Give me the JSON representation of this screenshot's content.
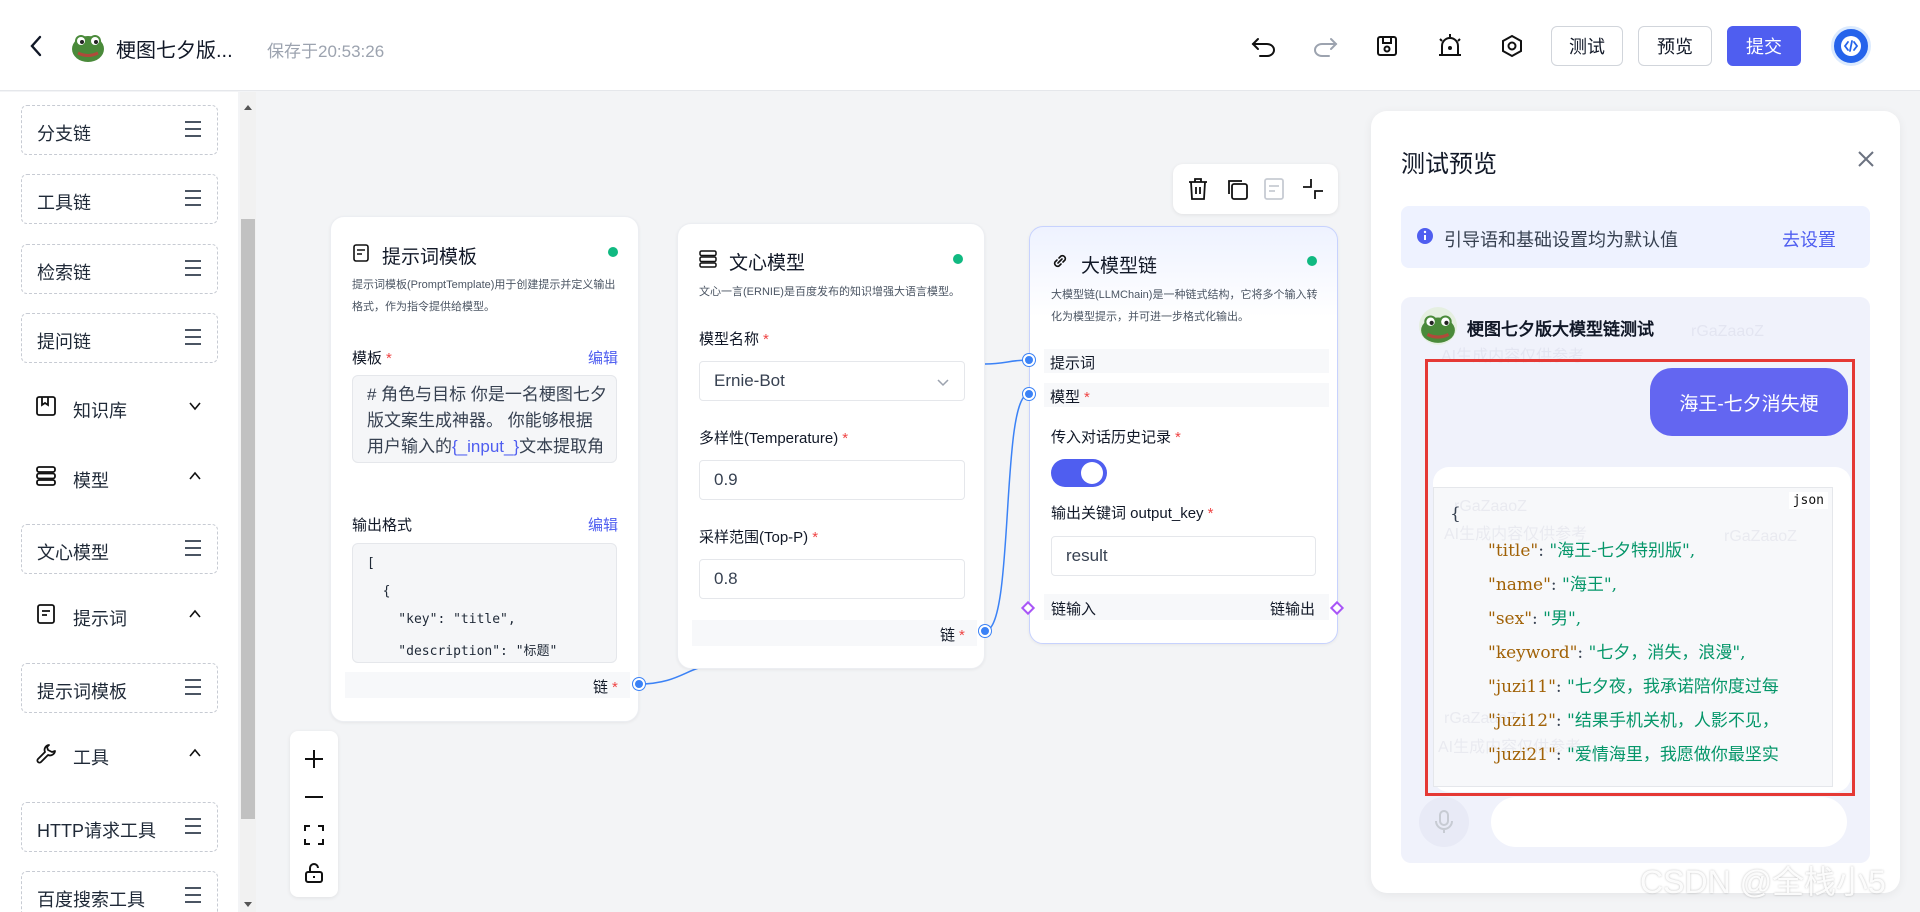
{
  "header": {
    "title": "梗图七夕版...",
    "saved_time": "保存于20:53:26",
    "buttons": {
      "test": "测试",
      "preview": "预览",
      "submit": "提交"
    }
  },
  "sidebar": {
    "items": [
      {
        "label": "分支链"
      },
      {
        "label": "工具链"
      },
      {
        "label": "检索链"
      },
      {
        "label": "提问链"
      }
    ],
    "groups": [
      {
        "label": "知识库",
        "expanded": false
      },
      {
        "label": "模型",
        "expanded": true,
        "items": [
          {
            "label": "文心模型"
          }
        ]
      },
      {
        "label": "提示词",
        "expanded": true,
        "items": [
          {
            "label": "提示词模板"
          }
        ]
      },
      {
        "label": "工具",
        "expanded": true,
        "items": [
          {
            "label": "HTTP请求工具"
          },
          {
            "label": "百度搜索工具"
          }
        ]
      }
    ]
  },
  "nodes": {
    "prompt": {
      "title": "提示词模板",
      "desc": "提示词模板(PromptTemplate)用于创建提示并定义输出格式，作为指令提供给模型。",
      "template_label": "模板",
      "edit": "编辑",
      "template_text_1": "# 角色与目标 你是一名梗图七夕版文案生成神器。 你能够根据用户输入的",
      "template_var": "{_input_}",
      "template_text_2": "文本提取角色名称，然后根据这个角",
      "output_label": "输出格式",
      "output_lines": [
        "[",
        "  {",
        "    \"key\": \"title\",",
        "    \"description\": \"标题\""
      ],
      "chain": "链"
    },
    "wenxin": {
      "title": "文心模型",
      "desc": "文心一言(ERNIE)是百度发布的知识增强大语言模型。",
      "model_label": "模型名称",
      "model_value": "Ernie-Bot",
      "temp_label": "多样性(Temperature)",
      "temp_value": "0.9",
      "topp_label": "采样范围(Top-P)",
      "topp_value": "0.8",
      "chain": "链"
    },
    "llmchain": {
      "title": "大模型链",
      "desc": "大模型链(LLMChain)是一种链式结构，它将多个输入转化为模型提示，并可进一步格式化输出。",
      "prompt_port": "提示词",
      "model_port": "模型",
      "history_label": "传入对话历史记录",
      "history_on": true,
      "output_key_label": "输出关键词 output_key",
      "output_key_value": "result",
      "chain_in": "链输入",
      "chain_out": "链输出"
    }
  },
  "panel": {
    "title": "测试预览",
    "notice": "引导语和基础设置均为默认值",
    "notice_link": "去设置",
    "bot_name": "梗图七夕版大模型链测试",
    "user_message": "海王-七夕消失梗",
    "code_lang": "json",
    "code_open": "{",
    "code_rows": [
      {
        "key": "\"title\"",
        "value": "\"海王-七夕特别版\","
      },
      {
        "key": "\"name\"",
        "value": "\"海王\","
      },
      {
        "key": "\"sex\"",
        "value": "\"男\","
      },
      {
        "key": "\"keyword\"",
        "value": "\"七夕，消失，浪漫\","
      },
      {
        "key": "\"juzi11\"",
        "value": "\"七夕夜，我承诺陪你度过每"
      },
      {
        "key": "\"juzi12\"",
        "value": "\"结果手机关机，人影不见，"
      },
      {
        "key": "\"juzi21\"",
        "value": "\"爱情海里，我愿做你最坚实"
      }
    ],
    "watermark": "CSDN @全栈小5"
  },
  "colors": {
    "accent": "#4f5ef0",
    "highlight_border": "#e53935",
    "status_green": "#10b981"
  }
}
